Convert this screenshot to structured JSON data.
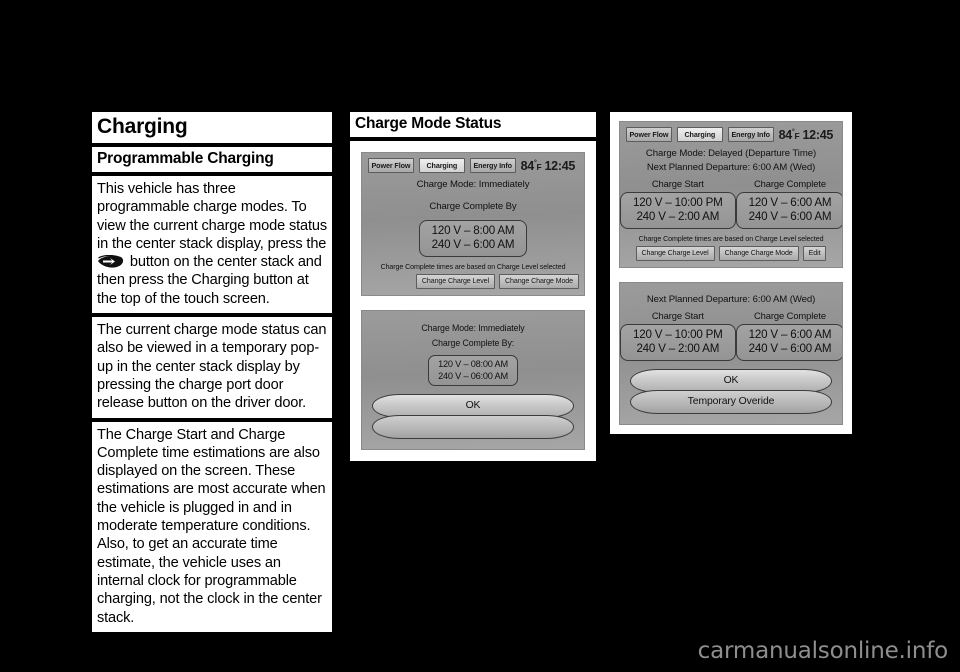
{
  "page": {
    "watermark": "carmanualsonline.info"
  },
  "left_column": {
    "title": "Charging",
    "subtitle": "Programmable Charging",
    "paragraph_1_a": "This vehicle has three programmable charge modes. To view the current charge mode status in the center stack display, press the",
    "icon_name": "energy-leaf-button-icon",
    "paragraph_1_b": "button on the center stack and then press the Charging button at the top of the touch screen.",
    "paragraph_2": "The current charge mode status can also be viewed in a temporary pop-up in the center stack display by pressing the charge port door release button on the driver door.",
    "paragraph_3": "The Charge Start and Charge Complete time estimations are also displayed on the screen. These estimations are most accurate when the vehicle is plugged in and in moderate temperature conditions. Also, to get an accurate time estimate, the vehicle uses an internal clock for programmable charging, not the clock in the center stack."
  },
  "middle_column": {
    "title": "Charge Mode Status",
    "screen_1": {
      "tabs": [
        "Power Flow",
        "Charging",
        "Energy Info"
      ],
      "selected_tab": "Charging",
      "temperature": "84",
      "temperature_unit": "F",
      "clock": "12:45",
      "charge_mode": "Charge Mode: Immediately",
      "complete_by_label": "Charge Complete By",
      "value_120": "120 V – 8:00 AM",
      "value_240": "240 V – 6:00 AM",
      "note": "Charge Complete times are based on Charge Level selected",
      "buttons": [
        "Change Charge Level",
        "Change Charge Mode"
      ]
    },
    "screen_2": {
      "charge_mode": "Charge Mode: Immediately",
      "complete_by_label": "Charge Complete By:",
      "value_120": "120 V – 08:00 AM",
      "value_240": "240 V – 06:00 AM",
      "ok_label": "OK"
    }
  },
  "right_column": {
    "screen_1": {
      "tabs": [
        "Power Flow",
        "Charging",
        "Energy Info"
      ],
      "selected_tab": "Charging",
      "temperature": "84",
      "temperature_unit": "F",
      "clock": "12:45",
      "charge_mode": "Charge Mode: Delayed (Departure Time)",
      "next_departure": "Next Planned Departure: 6:00 AM (Wed)",
      "start_label": "Charge Start",
      "complete_label": "Charge Complete",
      "start_120": "120 V – 10:00 PM",
      "start_240": "240 V – 2:00 AM",
      "complete_120": "120 V – 6:00 AM",
      "complete_240": "240 V – 6:00 AM",
      "note": "Charge Complete times are based on Charge Level selected",
      "buttons": [
        "Change Charge Level",
        "Change Charge Mode",
        "Edit"
      ]
    },
    "screen_2": {
      "next_departure": "Next Planned Departure: 6:00 AM (Wed)",
      "start_label": "Charge Start",
      "complete_label": "Charge Complete",
      "start_120": "120 V – 10:00 PM",
      "start_240": "240 V – 2:00 AM",
      "complete_120": "120 V – 6:00 AM",
      "complete_240": "240 V – 6:00 AM",
      "ok_label": "OK",
      "override_label": "Temporary Overide"
    }
  }
}
